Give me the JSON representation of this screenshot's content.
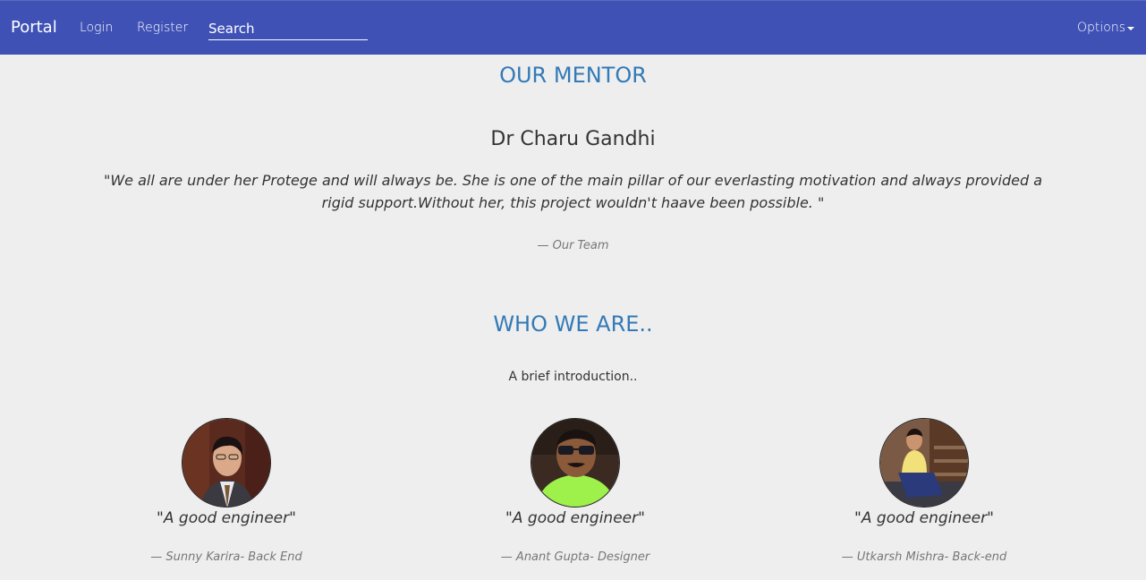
{
  "navbar": {
    "brand": "Portal",
    "login": "Login",
    "register": "Register",
    "search_placeholder": "Search",
    "options": "Options"
  },
  "mentor": {
    "title": "OUR MENTOR",
    "name": "Dr Charu Gandhi",
    "quote": "\"We all are under her Protege and will always be. She is one of the main pillar of our everlasting motivation and always provided a rigid support.Without her, this project wouldn't haave been possible. \"",
    "cite": "— Our Team"
  },
  "team": {
    "title": "WHO WE ARE..",
    "intro": "A brief introduction..",
    "members": [
      {
        "quote": "\"A good engineer\"",
        "cite": "— Sunny Karira- Back End"
      },
      {
        "quote": "\"A good engineer\"",
        "cite": "— Anant Gupta- Designer"
      },
      {
        "quote": "\"A good engineer\"",
        "cite": "— Utkarsh Mishra- Back-end"
      }
    ]
  },
  "colors": {
    "navbar": "#3f51b5",
    "heading": "#337ab7",
    "background": "#eeeeee"
  }
}
